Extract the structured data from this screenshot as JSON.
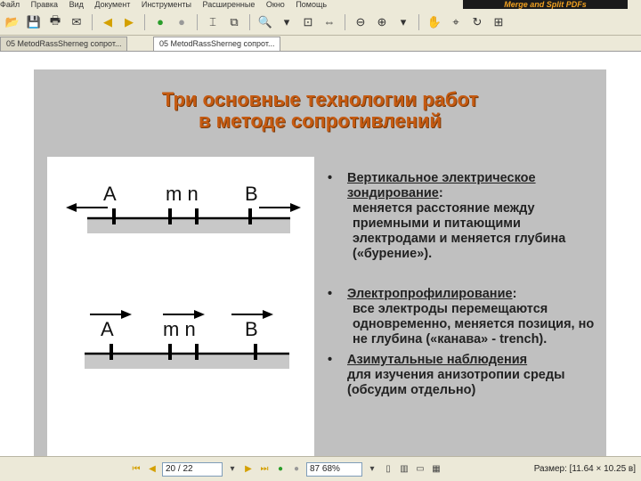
{
  "menu": {
    "items": [
      "Файл",
      "Правка",
      "Вид",
      "Документ",
      "Инструменты",
      "Расширенные",
      "Окно",
      "Помощь"
    ],
    "promo": "Merge and Split PDFs"
  },
  "tabs": [
    {
      "label": "05 MetodRassSherneg сопрот..."
    },
    {
      "label": "05 MetodRassSherneg сопрот..."
    }
  ],
  "slide": {
    "title_line1": "Три основные технологии работ",
    "title_line2": "в методе сопротивлений",
    "diagram": {
      "top_labels": [
        "A",
        "m n",
        "B"
      ],
      "bottom_labels": [
        "A",
        "m n",
        "B"
      ]
    },
    "bullets": [
      {
        "dot": "•",
        "head": "Вертикальное электрическое зондирование",
        "tail": ":",
        "body": "меняется расстояние между приемными и питающими электродами и меняется глубина («бурение»)."
      },
      {
        "dot": "•",
        "head": "Электропрофилирование",
        "tail": ":",
        "body": "все электроды перемещаются одновременно, меняется позиция, но не глубина («канава» - trench)."
      },
      {
        "dot": "•",
        "head": "Азимутальные наблюдения",
        "tail": "",
        "body": "для изучения анизотропии среды (обсудим отдельно)"
      }
    ]
  },
  "statusbar": {
    "page": "20 / 22",
    "zoom": "87 68%",
    "size": "Размер: [11.64 × 10.25 в]"
  },
  "colors": {
    "title": "#c55a11",
    "slide_bg": "#c0c0c0",
    "chrome": "#ece9d8"
  }
}
